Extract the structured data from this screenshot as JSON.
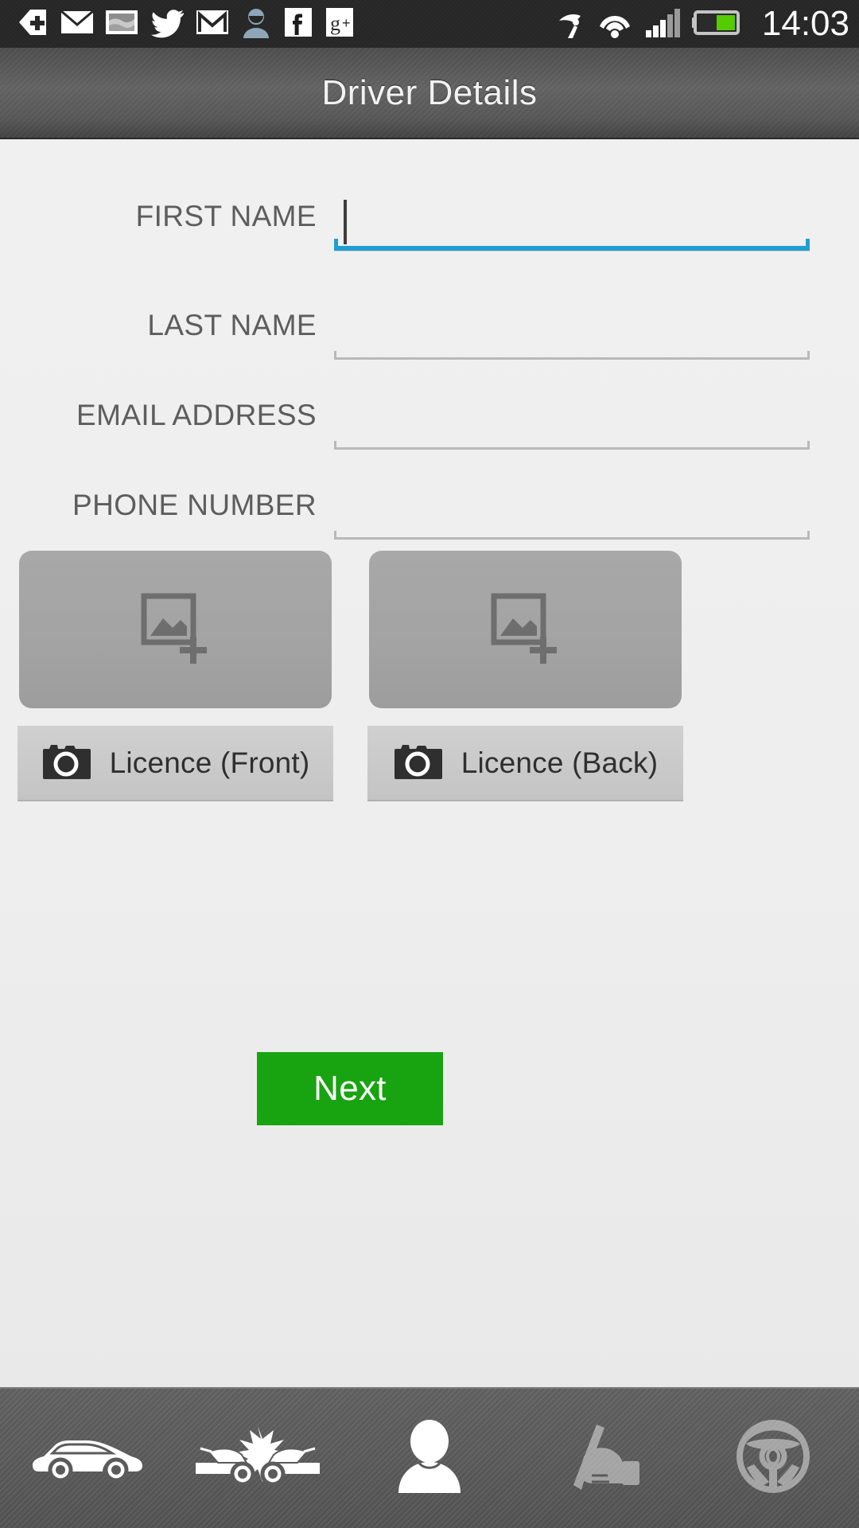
{
  "statusbar": {
    "time": "14:03",
    "left_icons": [
      {
        "name": "plus-arrow-icon",
        "label": "app update"
      },
      {
        "name": "envelope-icon",
        "label": "mail"
      },
      {
        "name": "photo-icon",
        "label": "screenshot"
      },
      {
        "name": "twitter-icon",
        "label": "Twitter"
      },
      {
        "name": "gmail-icon",
        "label": "Gmail"
      },
      {
        "name": "person-avatar-icon",
        "label": "contact"
      },
      {
        "name": "facebook-icon",
        "label": "Facebook"
      },
      {
        "name": "google-plus-icon",
        "label": "Google+"
      }
    ],
    "right_icons": [
      {
        "name": "gps-satellite-icon",
        "label": "GPS"
      },
      {
        "name": "wifi-icon",
        "label": "Wi-Fi"
      },
      {
        "name": "cell-signal-icon",
        "label": "Signal"
      },
      {
        "name": "battery-icon",
        "label": "Battery"
      }
    ]
  },
  "titlebar": {
    "title": "Driver Details"
  },
  "form": {
    "fields": [
      {
        "label": "FIRST NAME",
        "value": "",
        "placeholder": "",
        "focused": true
      },
      {
        "label": "LAST NAME",
        "value": "",
        "placeholder": "",
        "focused": false
      },
      {
        "label": "EMAIL ADDRESS",
        "value": "",
        "placeholder": "",
        "focused": false
      },
      {
        "label": "PHONE NUMBER",
        "value": "",
        "placeholder": "",
        "focused": false
      }
    ]
  },
  "photos": [
    {
      "placeholder_icon": "add-image-icon",
      "button_label": "Licence (Front)",
      "button_icon": "camera-icon"
    },
    {
      "placeholder_icon": "add-image-icon",
      "button_label": "Licence (Back)",
      "button_icon": "camera-icon"
    }
  ],
  "next_button": {
    "label": "Next",
    "color": "#18a311",
    "text_color": "#ffffff"
  },
  "bottom_nav": {
    "items": [
      {
        "name": "nav-car",
        "icon": "car-icon",
        "label": "Vehicle",
        "active": true
      },
      {
        "name": "nav-accident",
        "icon": "car-crash-icon",
        "label": "Accident",
        "active": true
      },
      {
        "name": "nav-driver",
        "icon": "person-icon",
        "label": "Driver",
        "active": true
      },
      {
        "name": "nav-signature",
        "icon": "hand-writing-icon",
        "label": "Sign",
        "active": false
      },
      {
        "name": "nav-steering",
        "icon": "steering-wheel-icon",
        "label": "Steering",
        "active": false
      }
    ]
  },
  "colors": {
    "accent_blue": "#1f9ed2",
    "accent_green": "#18a311",
    "background": "#efefef",
    "titlebar": "#5a5a5a",
    "label_text": "#5d5d5d",
    "photo_box": "#a3a3a3",
    "licence_button": "#cacaca"
  }
}
